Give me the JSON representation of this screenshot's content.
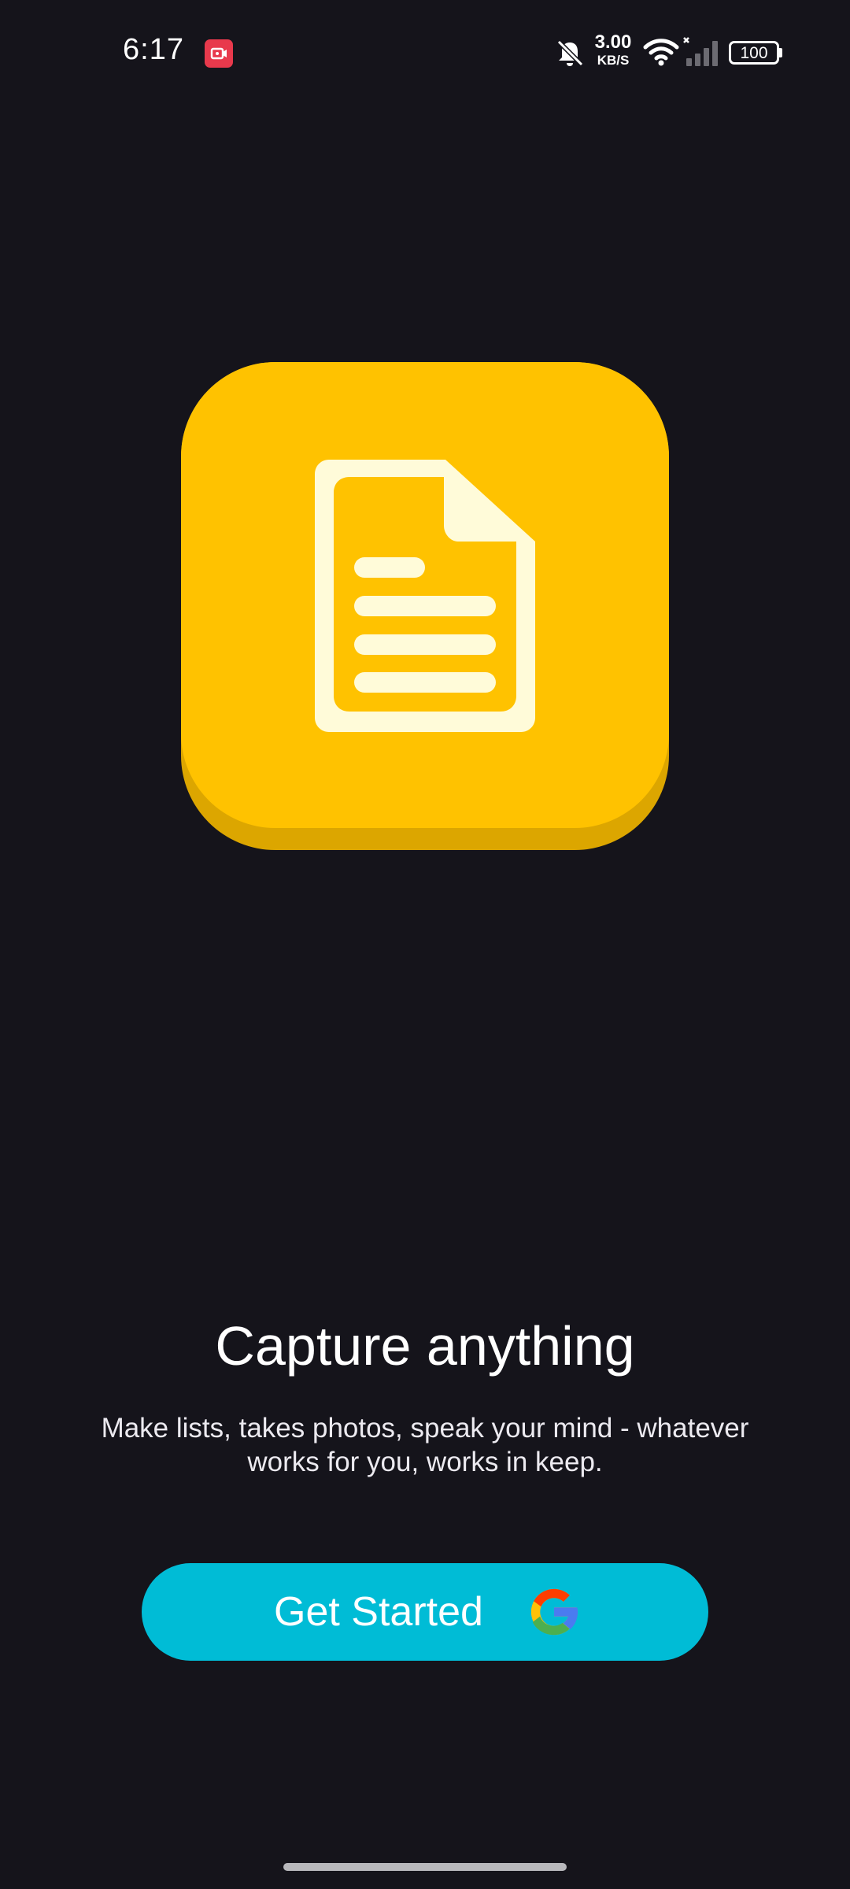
{
  "status_bar": {
    "time": "6:17",
    "net_speed_value": "3.00",
    "net_speed_unit": "KB/S",
    "battery": "100",
    "icons": [
      "screen-record-icon",
      "bell-off-icon",
      "wifi-icon",
      "signal-icon",
      "battery-icon"
    ]
  },
  "app_icon": {
    "name": "notes-document-icon",
    "colors": {
      "face": "#ffc200",
      "shadow": "#dca600",
      "glyph": "#fffbd9"
    }
  },
  "onboarding": {
    "title": "Capture anything",
    "description": "Make lists, takes photos, speak your mind - whatever works for you, works in keep."
  },
  "cta": {
    "label": "Get Started",
    "icon": "google-icon",
    "color": "#00bcd6"
  },
  "theme": {
    "background": "#15141b"
  }
}
